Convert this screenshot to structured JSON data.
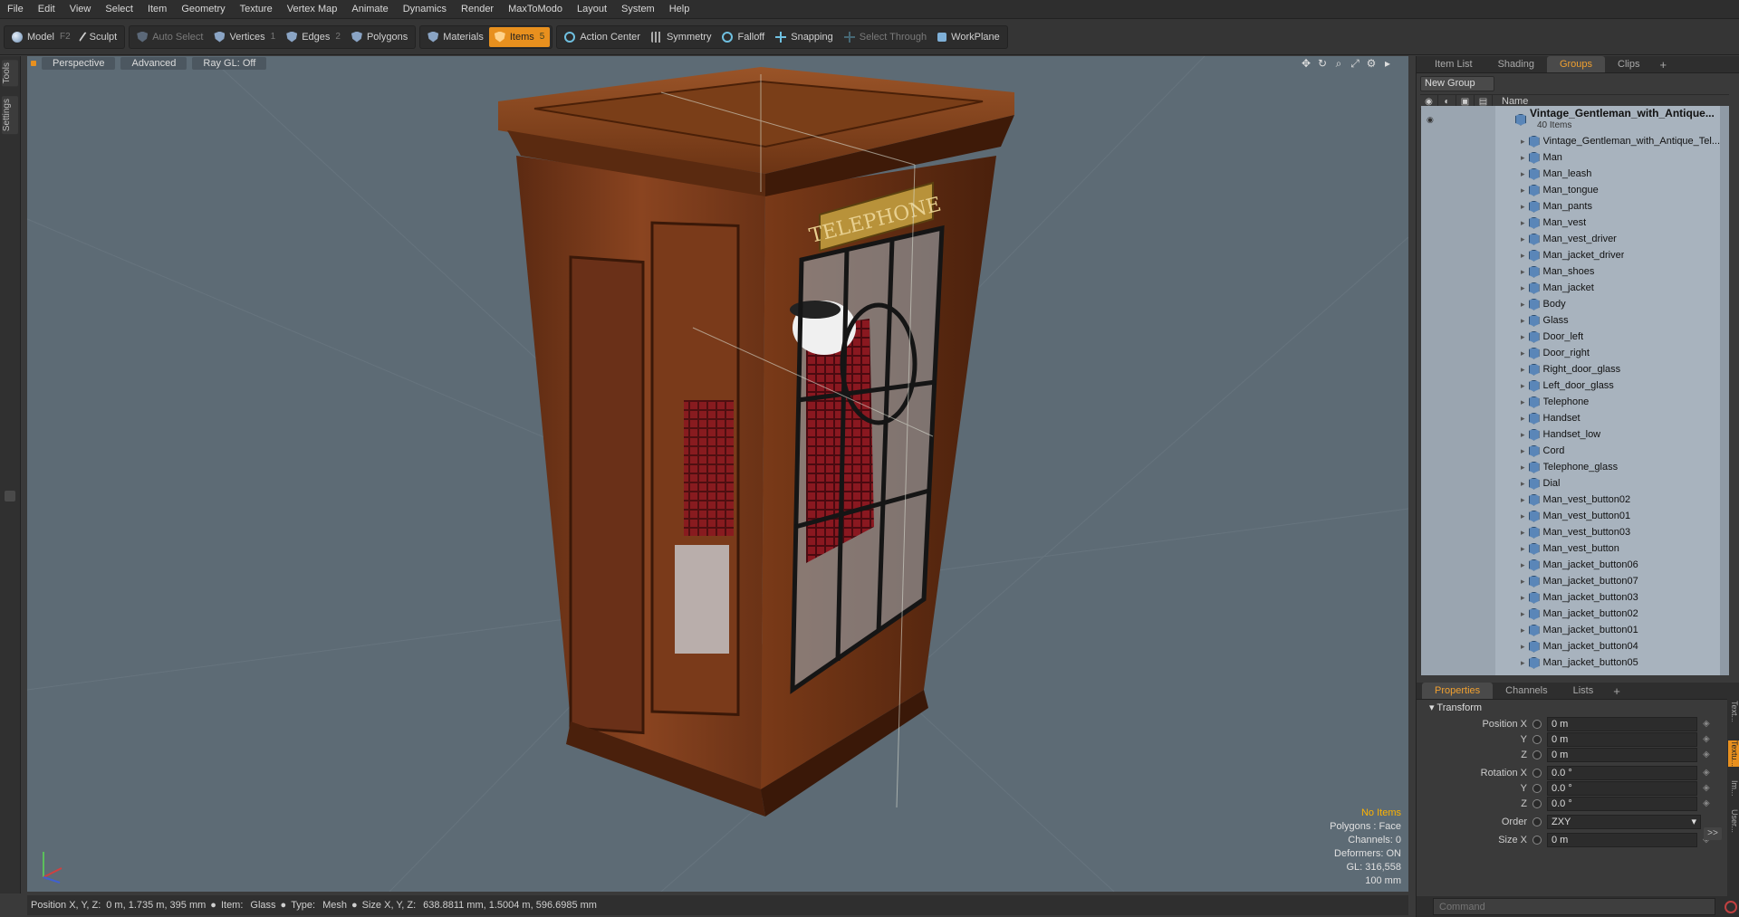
{
  "menu": [
    "File",
    "Edit",
    "View",
    "Select",
    "Item",
    "Geometry",
    "Texture",
    "Vertex Map",
    "Animate",
    "Dynamics",
    "Render",
    "MaxToModo",
    "Layout",
    "System",
    "Help"
  ],
  "toolbar": {
    "model": "Model",
    "model_key": "F2",
    "sculpt": "Sculpt",
    "auto_select": "Auto Select",
    "vertices": "Vertices",
    "vertices_key": "1",
    "edges": "Edges",
    "edges_key": "2",
    "polygons": "Polygons",
    "materials": "Materials",
    "items": "Items",
    "items_key": "5",
    "action_center": "Action Center",
    "symmetry": "Symmetry",
    "falloff": "Falloff",
    "snapping": "Snapping",
    "select_through": "Select Through",
    "workplane": "WorkPlane"
  },
  "left_tabs": [
    "Tools",
    "Settings"
  ],
  "viewport": {
    "view": "Perspective",
    "mode": "Advanced",
    "raygl": "Ray GL: Off",
    "sign": "TELEPHONE",
    "info": {
      "selection": "No Items",
      "polygons": "Polygons : Face",
      "channels": "Channels: 0",
      "deformers": "Deformers: ON",
      "gl": "GL: 316,558",
      "scale": "100 mm"
    }
  },
  "status": {
    "pos_label": "Position X, Y, Z:",
    "pos_value": "0 m, 1.735 m, 395 mm",
    "item_label": "Item:",
    "item_value": "Glass",
    "type_label": "Type:",
    "type_value": "Mesh",
    "size_label": "Size X, Y, Z:",
    "size_value": "638.8811 mm, 1.5004 m, 596.6985 mm"
  },
  "panel_top": {
    "tabs": [
      "Item List",
      "Shading",
      "Groups",
      "Clips"
    ],
    "active_tab": "Groups",
    "new_group": "New Group",
    "name_col": "Name",
    "root": {
      "name": "Vintage_Gentleman_with_Antique...",
      "count": "40 Items"
    },
    "items": [
      "Vintage_Gentleman_with_Antique_Tel...",
      "Man",
      "Man_leash",
      "Man_tongue",
      "Man_pants",
      "Man_vest",
      "Man_vest_driver",
      "Man_jacket_driver",
      "Man_shoes",
      "Man_jacket",
      "Body",
      "Glass",
      "Door_left",
      "Door_right",
      "Right_door_glass",
      "Left_door_glass",
      "Telephone",
      "Handset",
      "Handset_low",
      "Cord",
      "Telephone_glass",
      "Dial",
      "Man_vest_button02",
      "Man_vest_button01",
      "Man_vest_button03",
      "Man_vest_button",
      "Man_jacket_button06",
      "Man_jacket_button07",
      "Man_jacket_button03",
      "Man_jacket_button02",
      "Man_jacket_button01",
      "Man_jacket_button04",
      "Man_jacket_button05"
    ]
  },
  "panel_bottom": {
    "tabs": [
      "Properties",
      "Channels",
      "Lists"
    ],
    "active_tab": "Properties",
    "section": "Transform",
    "rows": [
      {
        "label": "Position X",
        "value": "0 m"
      },
      {
        "label": "Y",
        "value": "0 m"
      },
      {
        "label": "Z",
        "value": "0 m"
      },
      {
        "label": "Rotation X",
        "value": "0.0 °"
      },
      {
        "label": "Y",
        "value": "0.0 °"
      },
      {
        "label": "Z",
        "value": "0.0 °"
      },
      {
        "label": "Order",
        "value": "ZXY"
      },
      {
        "label": "Size X",
        "value": "0 m"
      }
    ],
    "more": ">>",
    "side_tabs": [
      "Text...",
      "Textu...",
      "Im...",
      "User..."
    ]
  },
  "command": {
    "placeholder": "Command"
  }
}
